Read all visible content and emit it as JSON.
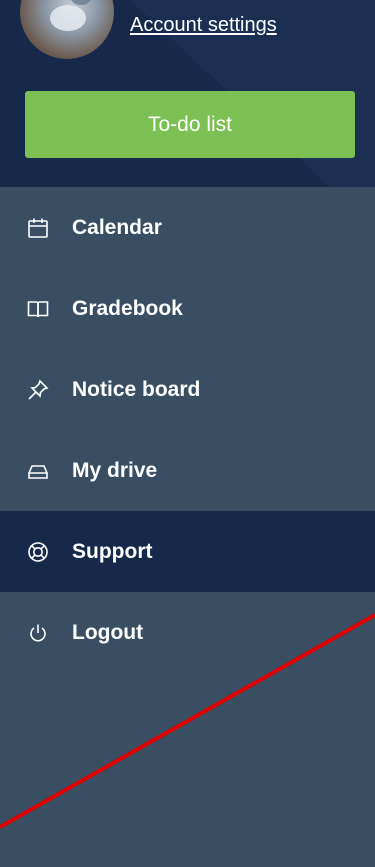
{
  "header": {
    "account_settings_label": "Account settings"
  },
  "todo": {
    "label": "To-do list"
  },
  "nav": {
    "items": [
      {
        "label": "Calendar",
        "icon": "calendar-icon"
      },
      {
        "label": "Gradebook",
        "icon": "book-icon"
      },
      {
        "label": "Notice board",
        "icon": "pin-icon"
      },
      {
        "label": "My drive",
        "icon": "drive-icon"
      },
      {
        "label": "Support",
        "icon": "lifebuoy-icon",
        "active": true
      },
      {
        "label": "Logout",
        "icon": "power-icon"
      }
    ]
  },
  "colors": {
    "sidebar_bg": "#3a4e63",
    "header_bg": "#16294a",
    "active_bg": "#16294a",
    "todo_green": "#7cbf53",
    "annotation_red": "#e00000"
  }
}
